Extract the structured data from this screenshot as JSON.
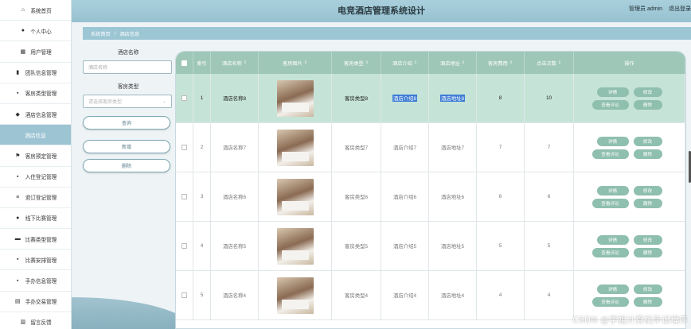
{
  "header": {
    "title": "电竞酒店管理系统设计",
    "user_label": "管理员 admin",
    "logout": "退出登录"
  },
  "sidebar": {
    "items": [
      {
        "label": "系统首页",
        "icon": "home-icon",
        "glyph": "⌂"
      },
      {
        "label": "个人中心",
        "icon": "user-icon",
        "glyph": "●"
      },
      {
        "label": "用户管理",
        "icon": "users-icon",
        "glyph": "▦"
      },
      {
        "label": "团队信息管理",
        "icon": "bar-chart-icon",
        "glyph": "▮"
      },
      {
        "label": "客房类型管理",
        "icon": "grid-icon",
        "glyph": "▪"
      },
      {
        "label": "酒店信息管理",
        "icon": "map-pin-icon",
        "glyph": "◆"
      },
      {
        "label": "酒店信息",
        "icon": "",
        "glyph": ""
      },
      {
        "label": "客房预定管理",
        "icon": "flag-icon",
        "glyph": "⚑"
      },
      {
        "label": "入住登记管理",
        "icon": "grid-icon",
        "glyph": "▪"
      },
      {
        "label": "退订登记管理",
        "icon": "list-icon",
        "glyph": "≡"
      },
      {
        "label": "线下比赛管理",
        "icon": "user-icon",
        "glyph": "●"
      },
      {
        "label": "比赛类型管理",
        "icon": "briefcase-icon",
        "glyph": "▬"
      },
      {
        "label": "比赛安排管理",
        "icon": "grid-icon",
        "glyph": "▪"
      },
      {
        "label": "手办信息管理",
        "icon": "grid-icon",
        "glyph": "▪"
      },
      {
        "label": "手办交易管理",
        "icon": "clipboard-icon",
        "glyph": "▤"
      },
      {
        "label": "留言反馈",
        "icon": "document-icon",
        "glyph": "▥"
      }
    ]
  },
  "breadcrumb": {
    "home": "系统首页",
    "sep": "/",
    "current": "酒店信息"
  },
  "search": {
    "name_label": "酒店名称",
    "name_placeholder": "酒店名称",
    "type_label": "客房类型",
    "type_placeholder": "请选择客房类型",
    "query_button": "查询",
    "add_button": "新增",
    "delete_button": "删除"
  },
  "table": {
    "columns": [
      "索引",
      "酒店名称",
      "客房图片",
      "客房类型",
      "酒店介绍",
      "酒店地址",
      "客房费用",
      "点击次数",
      "操作"
    ],
    "rows": [
      {
        "index": "1",
        "name": "酒店名称8",
        "type": "客房类型8",
        "intro": "酒店介绍8",
        "address": "酒店地址8",
        "fee": "8",
        "clicks": "10"
      },
      {
        "index": "2",
        "name": "酒店名称7",
        "type": "客房类型7",
        "intro": "酒店介绍7",
        "address": "酒店地址7",
        "fee": "7",
        "clicks": "7"
      },
      {
        "index": "3",
        "name": "酒店名称6",
        "type": "客房类型6",
        "intro": "酒店介绍6",
        "address": "酒店地址6",
        "fee": "6",
        "clicks": "6"
      },
      {
        "index": "4",
        "name": "酒店名称5",
        "type": "客房类型5",
        "intro": "酒店介绍5",
        "address": "酒店地址5",
        "fee": "5",
        "clicks": "5"
      },
      {
        "index": "5",
        "name": "酒店名称4",
        "type": "客房类型4",
        "intro": "酒店介绍4",
        "address": "酒店地址4",
        "fee": "4",
        "clicks": "4"
      }
    ],
    "actions": {
      "detail": "详情",
      "edit": "修改",
      "reviews": "查看评论",
      "delete": "删除"
    }
  },
  "watermark": "CSDN @学姐计算机毕设程序"
}
